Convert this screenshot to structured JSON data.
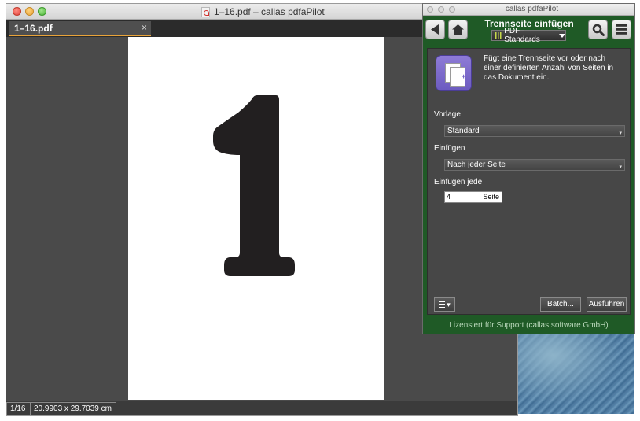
{
  "main_window": {
    "title": "1–16.pdf – callas pdfaPilot",
    "tab": {
      "label": "1–16.pdf",
      "close": "×"
    },
    "page_content": "1",
    "status": {
      "page": "1/16",
      "dimensions": "20.9903 x 29.7039 cm"
    }
  },
  "panel": {
    "window_title": "callas pdfaPilot",
    "header_title": "Trennseite einfügen",
    "profile_dropdown": "PDF–Standards",
    "icons": {
      "back": "back-arrow-icon",
      "home": "home-icon",
      "search": "search-icon",
      "menu": "menu-icon"
    },
    "description": "Fügt eine Trennseite vor oder nach einer definierten Anzahl von Seiten in das Dokument ein.",
    "fields": {
      "vorlage_label": "Vorlage",
      "vorlage_value": "Standard",
      "einfuegen_label": "Einfügen",
      "einfuegen_value": "Nach jeder Seite",
      "einfuegen_jede_label": "Einfügen jede",
      "einfuegen_jede_value": "4",
      "einfuegen_jede_unit": "Seite"
    },
    "buttons": {
      "batch": "Batch...",
      "run": "Ausführen"
    },
    "license": "Lizensiert für Support (callas software GmbH)"
  },
  "colors": {
    "panel_green": "#1f5a26",
    "tab_accent": "#e8a33a",
    "dark_gray": "#4a4a4a"
  }
}
